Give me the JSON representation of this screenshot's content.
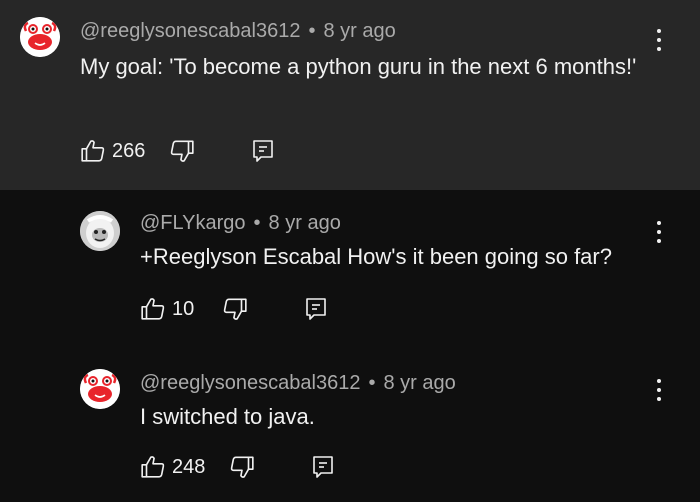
{
  "comments": [
    {
      "author": "@reeglysonescabal3612",
      "separator": "•",
      "age": "8 yr ago",
      "text": "My goal: 'To become a python guru in the next 6 months!'",
      "likes": "266",
      "avatar_icon": "crab-avatar-icon"
    },
    {
      "author": "@FLYkargo",
      "separator": "•",
      "age": "8 yr ago",
      "text": "+Reeglyson Escabal How's it been going so far?",
      "likes": "10",
      "avatar_icon": "yeti-avatar-icon"
    },
    {
      "author": "@reeglysonescabal3612",
      "separator": "•",
      "age": "8 yr ago",
      "text": "I switched to java.",
      "likes": "248",
      "avatar_icon": "crab-avatar-icon"
    }
  ],
  "colors": {
    "background": "#0f0f0f",
    "highlight_background": "#272727",
    "primary_text": "#f1f1f1",
    "secondary_text": "#aaaaaa",
    "crab_red": "#e8242b"
  }
}
